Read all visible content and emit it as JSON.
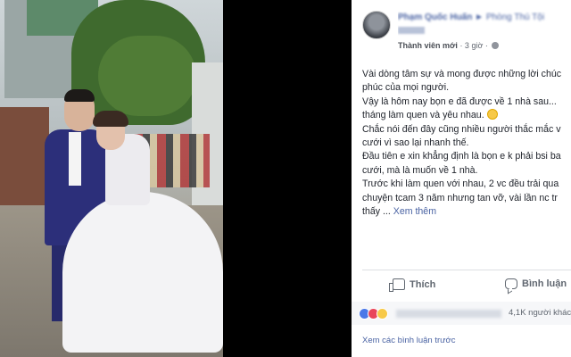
{
  "post": {
    "author": "Phạm Quốc Huấn",
    "arrow": "►",
    "page": "Phòng Thú Tội",
    "role": "Thành viên mới",
    "time": "· 3 giờ ·",
    "body_lines": [
      "Vài dòng tâm sự và mong được những lời chúc",
      "phúc của mọi người.",
      "Vậy là hôm nay bọn e đã được về 1 nhà sau...",
      "tháng làm quen và yêu nhau.",
      "Chắc nói đến đây cũng nhiều người thắc mắc v",
      "cưới vì sao lại nhanh thế.",
      "Đầu tiên e xin khẳng định là bọn e k phải bsi ba",
      "cưới, mà là muốn về 1 nhà.",
      "Trước khi làm quen với nhau, 2 vc đều trải qua",
      "chuyện tcam 3 năm nhưng tan vỡ, vài lần nc tr",
      "thấy ..."
    ],
    "see_more": "Xem thêm",
    "like_label": "Thích",
    "comment_label": "Bình luận",
    "reaction_count": "4,1K người khác",
    "view_comments": "Xem các bình luận trước"
  },
  "icons": [
    "avatar",
    "globe-icon",
    "smile-emoji",
    "like-icon",
    "comment-icon",
    "like-reaction-icon",
    "love-reaction-icon",
    "haha-reaction-icon"
  ],
  "colors": {
    "link": "#4a63a3",
    "text": "#1d2129",
    "muted": "#606770",
    "like": "#4a78e8",
    "love": "#e9465a"
  }
}
